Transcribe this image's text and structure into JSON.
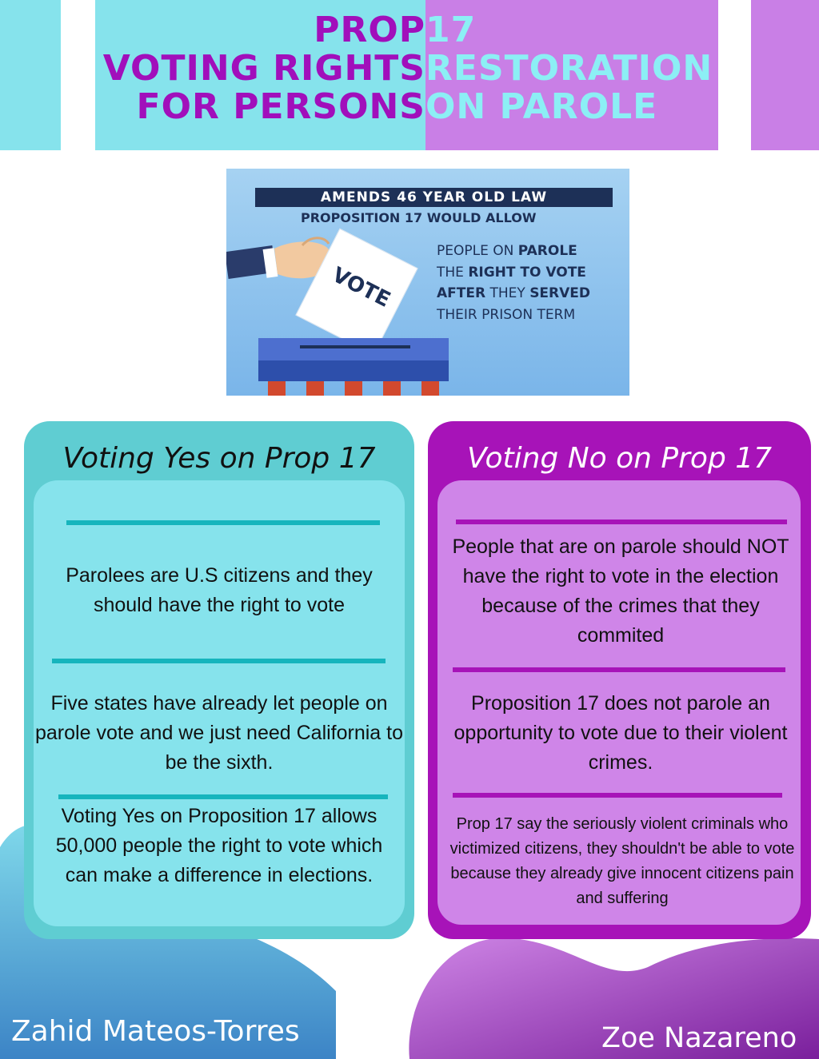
{
  "header": {
    "line1_left": "PROP ",
    "line1_right": "17",
    "line2_left": "VOTING RIGHTS ",
    "line2_right": "RESTORATION",
    "line3_left": "FOR PERSONS ",
    "line3_right": "ON PAROLE"
  },
  "illustration": {
    "banner": "AMENDS 46 YEAR OLD LAW",
    "subtitle": "PROPOSITION 17 WOULD ALLOW",
    "ballot_label": "VOTE",
    "lines": [
      {
        "pre": "PEOPLE ON ",
        "bold": "PAROLE",
        "post": ""
      },
      {
        "pre": "THE ",
        "bold": "RIGHT TO VOTE",
        "post": ""
      },
      {
        "pre": "",
        "bold": "AFTER",
        "post": " THEY ",
        "bold2": "SERVED"
      },
      {
        "pre": "THEIR PRISON TERM",
        "bold": "",
        "post": ""
      }
    ]
  },
  "yes_panel": {
    "title": "Voting Yes on Prop 17",
    "point1": "Parolees are U.S citizens and they should have the right to vote",
    "point2": "Five states have already let people on parole vote and we just need California to be the sixth.",
    "point3": "Voting Yes on Proposition 17 allows 50,000 people the right to vote which can make a difference in elections."
  },
  "no_panel": {
    "title": "Voting No on Prop 17",
    "point1": "People that are on parole should NOT have the right to vote in the election because of the crimes that they commited",
    "point2": "Proposition 17 does not parole an opportunity to vote due to their violent crimes.",
    "point3": "Prop 17 say the seriously violent criminals who victimized citizens, they shouldn't be able to vote because they already give innocent citizens pain and suffering"
  },
  "authors": {
    "left": "Zahid Mateos-Torres",
    "right": "Zoe Nazareno"
  },
  "colors": {
    "cyan": "#86e3ec",
    "teal": "#5fcdd2",
    "teal_rule": "#16b5bd",
    "purple": "#a713b8",
    "lavender": "#cf85e8",
    "navy": "#1d3057"
  }
}
